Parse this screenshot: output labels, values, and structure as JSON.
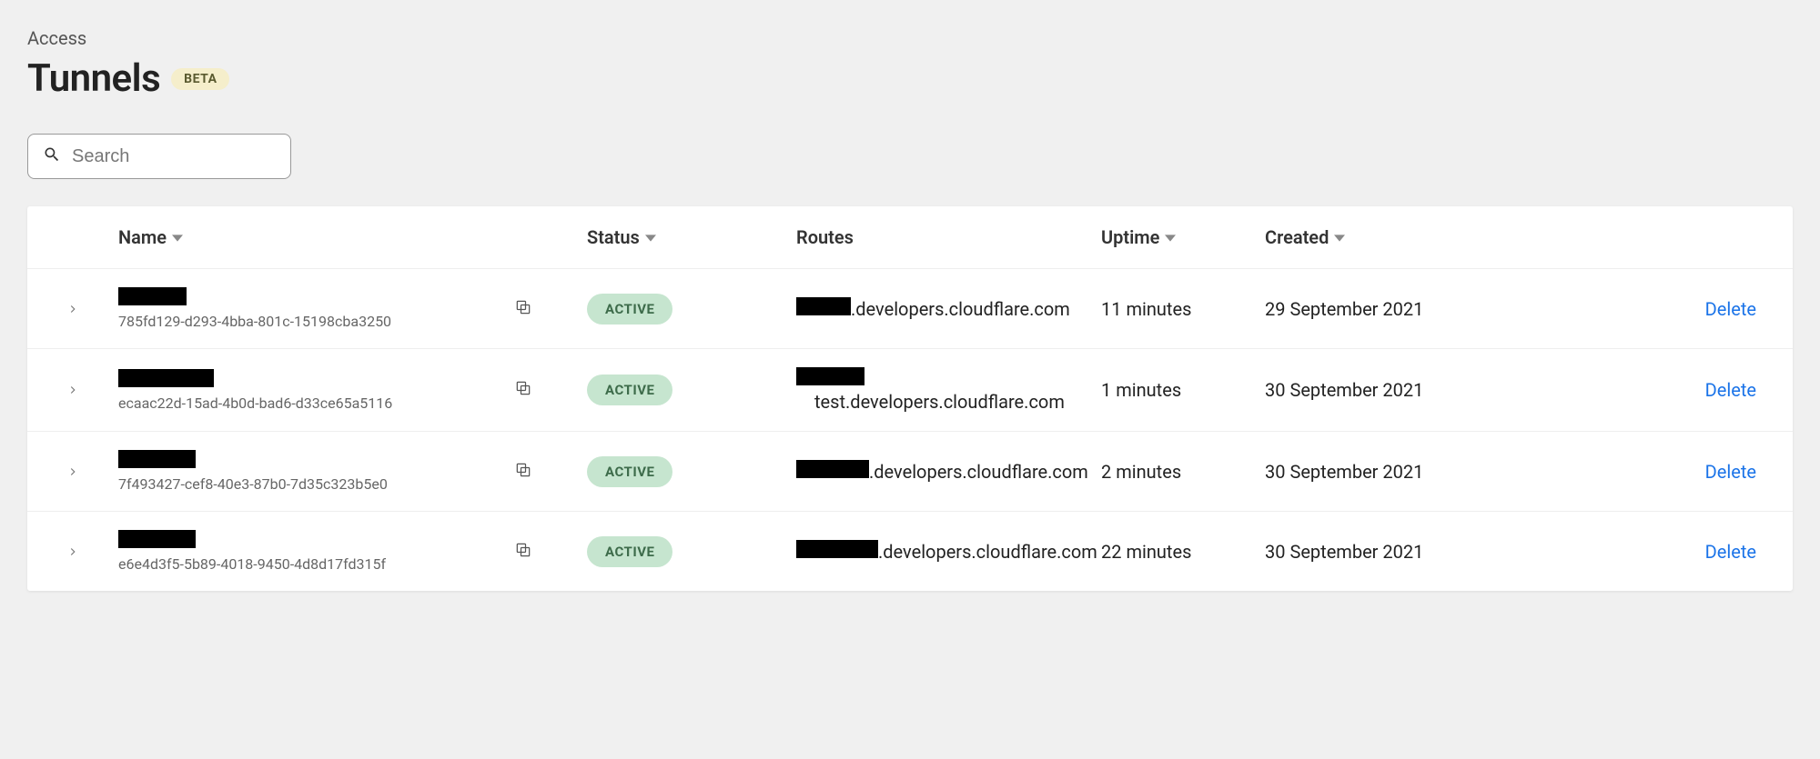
{
  "breadcrumb": "Access",
  "title": "Tunnels",
  "badge": "BETA",
  "search": {
    "placeholder": "Search"
  },
  "columns": {
    "name": "Name",
    "status": "Status",
    "routes": "Routes",
    "uptime": "Uptime",
    "created": "Created"
  },
  "actions": {
    "delete": "Delete"
  },
  "statusLabels": {
    "active": "ACTIVE"
  },
  "rows": [
    {
      "id": "785fd129-d293-4bba-801c-15198cba3250",
      "status": "ACTIVE",
      "routeSuffix": ".developers.cloudflare.com",
      "routeLine2": "",
      "uptime": "11 minutes",
      "created": "29 September 2021"
    },
    {
      "id": "ecaac22d-15ad-4b0d-bad6-d33ce65a5116",
      "status": "ACTIVE",
      "routeSuffix": "",
      "routeLine2": "test.developers.cloudflare.com",
      "uptime": "1 minutes",
      "created": "30 September 2021"
    },
    {
      "id": "7f493427-cef8-40e3-87b0-7d35c323b5e0",
      "status": "ACTIVE",
      "routeSuffix": ".developers.cloudflare.com",
      "routeLine2": "",
      "uptime": "2 minutes",
      "created": "30 September 2021"
    },
    {
      "id": "e6e4d3f5-5b89-4018-9450-4d8d17fd315f",
      "status": "ACTIVE",
      "routeSuffix": ".developers.cloudflare.com",
      "routeLine2": "",
      "uptime": "22 minutes",
      "created": "30 September 2021"
    }
  ]
}
